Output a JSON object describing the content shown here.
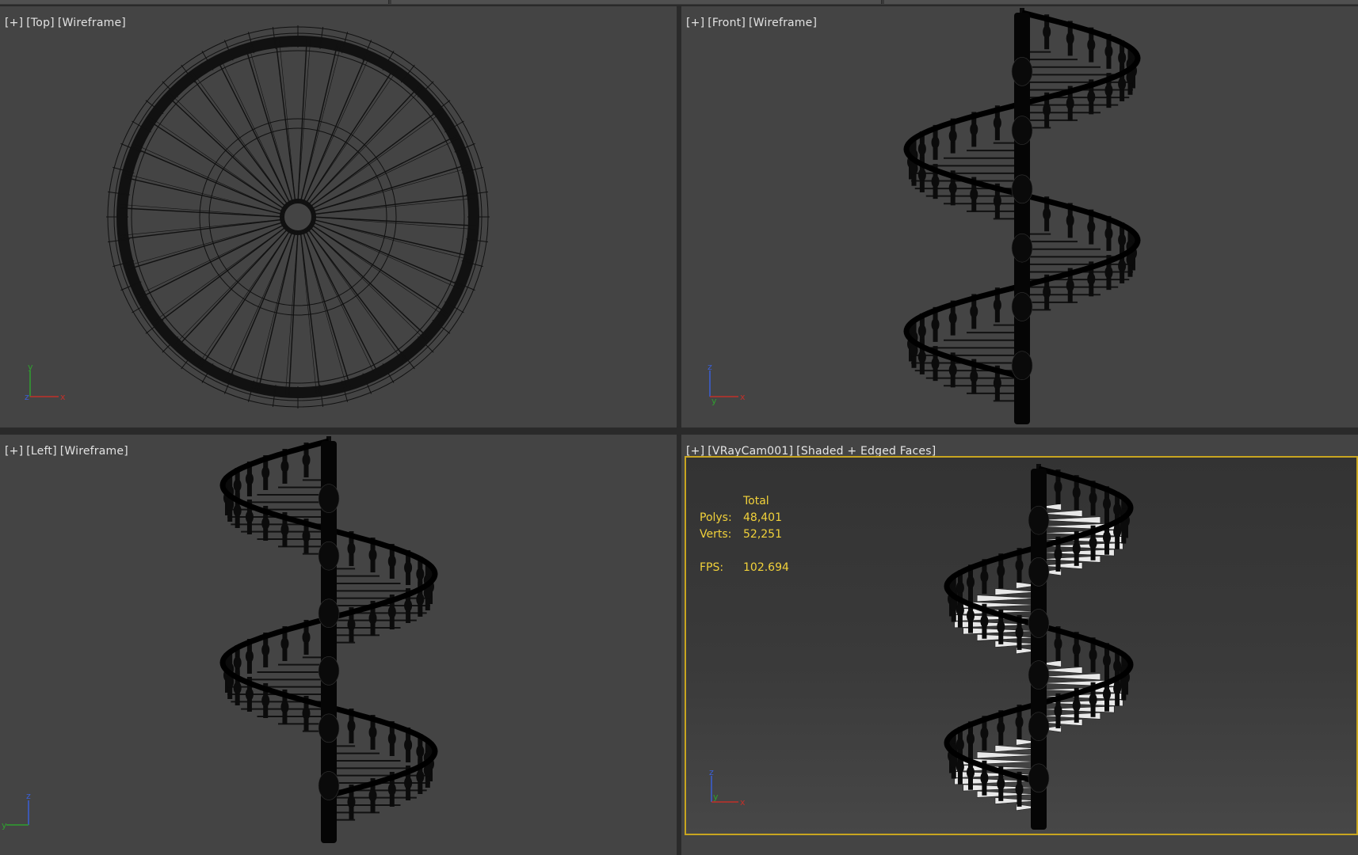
{
  "viewports": {
    "top": {
      "plus": "[+]",
      "view": "[Top]",
      "mode": "[Wireframe]"
    },
    "front": {
      "plus": "[+]",
      "view": "[Front]",
      "mode": "[Wireframe]"
    },
    "left": {
      "plus": "[+]",
      "view": "[Left]",
      "mode": "[Wireframe]"
    },
    "camera": {
      "plus": "[+]",
      "view": "[VRayCam001]",
      "mode": "[Shaded + Edged Faces]"
    }
  },
  "stats": {
    "header": "Total",
    "polys_label": "Polys:",
    "polys_value": "48,401",
    "verts_label": "Verts:",
    "verts_value": "52,251",
    "fps_label": "FPS:",
    "fps_value": "102.694"
  },
  "axes": {
    "top": {
      "vertical": "y",
      "horizontal": "x",
      "origin": "z"
    },
    "front": {
      "vertical": "z",
      "horizontal": "x",
      "origin": "y"
    },
    "left": {
      "vertical": "z",
      "horizontal": "y",
      "origin": ""
    },
    "camera": {
      "vertical": "z",
      "horizontal": "x",
      "origin": "y"
    }
  },
  "colors": {
    "viewport_bg": "#444444",
    "active_border": "#c8a520",
    "stats_text": "#f2d23a",
    "wire": "#111111",
    "axis_x": "#c0302a",
    "axis_y": "#2fa02f",
    "axis_z": "#3a5fd6"
  }
}
